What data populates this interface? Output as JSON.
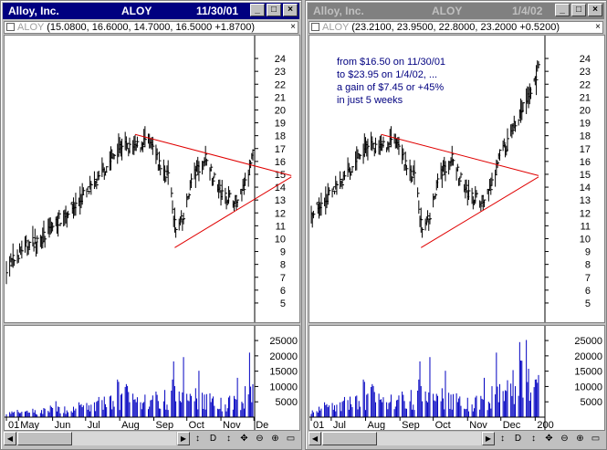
{
  "windows": [
    {
      "title": "Alloy, Inc.",
      "symbol": "ALOY",
      "date": "11/30/01",
      "infobar": {
        "symbol": "ALOY",
        "values": "(15.0800, 16.6000, 14.7000, 16.5000 +1.8700)"
      },
      "note": [],
      "price_axis_labels": [
        "24",
        "23",
        "22",
        "21",
        "20",
        "19",
        "18",
        "17",
        "16",
        "15",
        "14",
        "13",
        "12",
        "11",
        "10",
        "9",
        "8",
        "7",
        "6",
        "5"
      ],
      "volume_axis_labels": [
        "25000",
        "20000",
        "15000",
        "10000",
        "5000"
      ],
      "x_labels": [
        "01",
        "May",
        "Jun",
        "Jul",
        "Aug",
        "Sep",
        "Oct",
        "Nov",
        "De"
      ]
    },
    {
      "title": "Alloy, Inc.",
      "symbol": "ALOY",
      "date": "1/4/02",
      "infobar": {
        "symbol": "ALOY",
        "values": "(23.2100, 23.9500, 22.8000, 23.2000 +0.5200)"
      },
      "note": [
        "from $16.50 on 11/30/01",
        "to $23.95 on 1/4/02, ...",
        "a gain of $7.45 or +45%",
        "in just 5 weeks"
      ],
      "price_axis_labels": [
        "24",
        "23",
        "22",
        "21",
        "20",
        "19",
        "18",
        "17",
        "16",
        "15",
        "14",
        "13",
        "12",
        "11",
        "10",
        "9",
        "8",
        "7",
        "6",
        "5"
      ],
      "volume_axis_labels": [
        "25000",
        "20000",
        "15000",
        "10000",
        "5000"
      ],
      "x_labels": [
        "01",
        "Jul",
        "Aug",
        "Sep",
        "Oct",
        "Nov",
        "Dec",
        "200"
      ]
    }
  ],
  "toolbar_icons": [
    "refresh-icon",
    "d-icon",
    "vertical-move-icon",
    "crosshair-icon",
    "zoom-out-icon",
    "zoom-in-icon",
    "maximize-icon"
  ],
  "toolbar_glyphs": [
    "↕",
    "D",
    "↕",
    "✥",
    "⊖",
    "⊕",
    "▭"
  ],
  "chart_data": [
    {
      "type": "bar",
      "symbol": "ALOY",
      "ylim": [
        4.5,
        25
      ],
      "price_path": [
        [
          "2001-04-20",
          7.8
        ],
        [
          "2001-04-27",
          8.4
        ],
        [
          "2001-05-04",
          9.2
        ],
        [
          "2001-05-11",
          9.6
        ],
        [
          "2001-05-18",
          9.9
        ],
        [
          "2001-05-25",
          10.2
        ],
        [
          "2001-06-01",
          11.0
        ],
        [
          "2001-06-08",
          11.6
        ],
        [
          "2001-06-15",
          12.2
        ],
        [
          "2001-06-22",
          12.6
        ],
        [
          "2001-06-29",
          13.4
        ],
        [
          "2001-07-06",
          13.9
        ],
        [
          "2001-07-13",
          14.6
        ],
        [
          "2001-07-20",
          15.6
        ],
        [
          "2001-07-27",
          16.6
        ],
        [
          "2001-08-03",
          17.4
        ],
        [
          "2001-08-10",
          17.0
        ],
        [
          "2001-08-17",
          17.2
        ],
        [
          "2001-08-24",
          17.6
        ],
        [
          "2001-08-31",
          17.0
        ],
        [
          "2001-09-07",
          15.6
        ],
        [
          "2001-09-14",
          15.0
        ],
        [
          "2001-09-21",
          10.6
        ],
        [
          "2001-09-28",
          11.6
        ],
        [
          "2001-10-05",
          14.6
        ],
        [
          "2001-10-12",
          15.6
        ],
        [
          "2001-10-19",
          16.4
        ],
        [
          "2001-10-26",
          14.6
        ],
        [
          "2001-11-02",
          13.4
        ],
        [
          "2001-11-09",
          13.2
        ],
        [
          "2001-11-16",
          12.8
        ],
        [
          "2001-11-23",
          14.2
        ],
        [
          "2001-11-30",
          16.5
        ],
        [
          "2001-12-07",
          17.4
        ],
        [
          "2001-12-14",
          19.2
        ],
        [
          "2001-12-21",
          20.2
        ],
        [
          "2001-12-28",
          21.6
        ],
        [
          "2002-01-04",
          23.2
        ]
      ],
      "trendlines": [
        {
          "name": "upper",
          "from": [
            "2001-08-15",
            18.1
          ],
          "to": [
            "2002-01-04",
            14.9
          ]
        },
        {
          "name": "lower",
          "from": [
            "2001-09-20",
            9.3
          ],
          "to": [
            "2002-01-04",
            14.8
          ]
        }
      ],
      "volume": [
        [
          "2001-04-20",
          2000
        ],
        [
          "2001-05-04",
          2500
        ],
        [
          "2001-05-18",
          3000
        ],
        [
          "2001-06-01",
          4000
        ],
        [
          "2001-06-15",
          3500
        ],
        [
          "2001-06-29",
          5000
        ],
        [
          "2001-07-13",
          7000
        ],
        [
          "2001-07-27",
          8500
        ],
        [
          "2001-08-10",
          12000
        ],
        [
          "2001-08-24",
          8000
        ],
        [
          "2001-09-07",
          9000
        ],
        [
          "2001-09-21",
          14000
        ],
        [
          "2001-10-05",
          10000
        ],
        [
          "2001-10-19",
          8500
        ],
        [
          "2001-11-02",
          7500
        ],
        [
          "2001-11-16",
          9000
        ],
        [
          "2001-11-30",
          14500
        ],
        [
          "2001-12-07",
          15000
        ],
        [
          "2001-12-14",
          17000
        ],
        [
          "2001-12-21",
          25500
        ],
        [
          "2001-12-28",
          16500
        ],
        [
          "2002-01-04",
          14000
        ]
      ]
    }
  ]
}
